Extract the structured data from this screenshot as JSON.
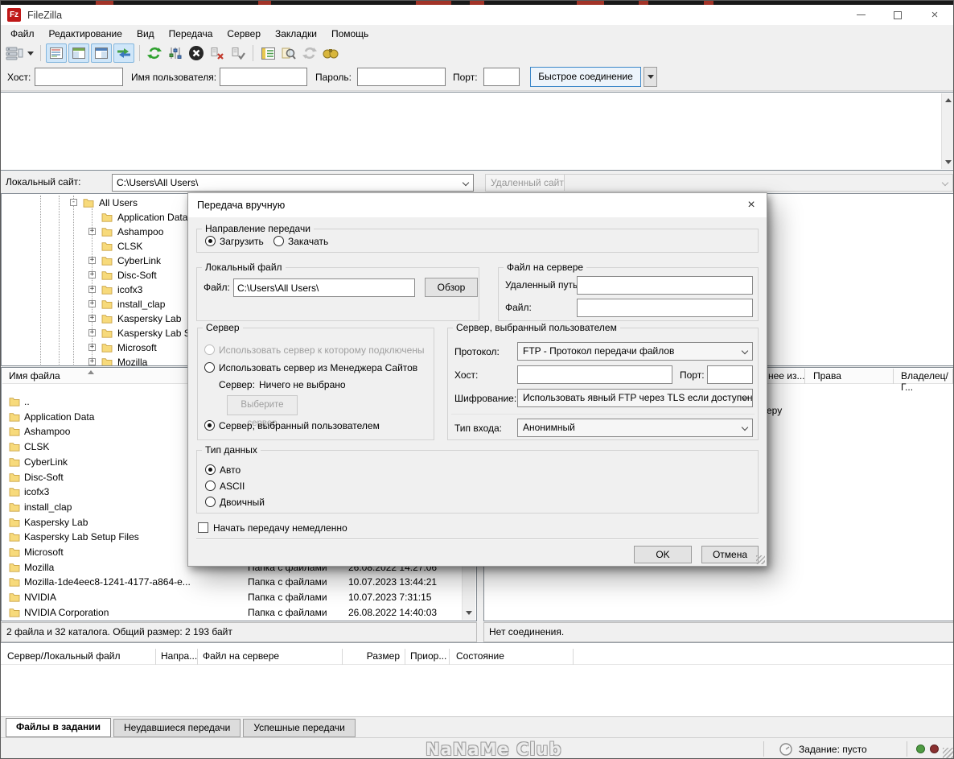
{
  "colors": {
    "accent_blue": "#3c87c8",
    "folder_yellow": "#f7da7b",
    "toggle_bg": "#cfe6f9",
    "status_green": "#4f9b43",
    "status_red": "#8a3030",
    "logo_red": "#bf1818"
  },
  "titlebar": {
    "app_title": "FileZilla",
    "logo_text": "Fz"
  },
  "menu": {
    "items": [
      "Файл",
      "Редактирование",
      "Вид",
      "Передача",
      "Сервер",
      "Закладки",
      "Помощь"
    ]
  },
  "toolbar": {
    "icons": [
      "site-manager",
      "site-manager-dropdown",
      "toggle-log",
      "toggle-local-tree",
      "toggle-remote-tree",
      "toggle-queue",
      "refresh",
      "process-queue",
      "cancel",
      "disconnect",
      "reconnect",
      "filter",
      "search",
      "synchronized-browsing",
      "compare"
    ]
  },
  "quickconnect": {
    "host_label": "Хост:",
    "host_value": "",
    "user_label": "Имя пользователя:",
    "user_value": "",
    "password_label": "Пароль:",
    "password_value": "",
    "port_label": "Порт:",
    "port_value": "",
    "connect_button": "Быстрое соединение"
  },
  "local_bar": {
    "label": "Локальный сайт:",
    "path": "C:\\Users\\All Users\\"
  },
  "remote_bar": {
    "label": "Удаленный сайт:",
    "path": ""
  },
  "local_tree": {
    "items": [
      {
        "label": "All Users",
        "expander": "minus",
        "level": 3
      },
      {
        "label": "Application Data",
        "expander": "none",
        "level": 4
      },
      {
        "label": "Ashampoo",
        "expander": "plus",
        "level": 4
      },
      {
        "label": "CLSK",
        "expander": "none",
        "level": 4
      },
      {
        "label": "CyberLink",
        "expander": "plus",
        "level": 4
      },
      {
        "label": "Disc-Soft",
        "expander": "plus",
        "level": 4
      },
      {
        "label": "icofx3",
        "expander": "plus",
        "level": 4
      },
      {
        "label": "install_clap",
        "expander": "plus",
        "level": 4
      },
      {
        "label": "Kaspersky Lab",
        "expander": "plus",
        "level": 4
      },
      {
        "label": "Kaspersky Lab Setup Files",
        "expander": "plus",
        "level": 4
      },
      {
        "label": "Microsoft",
        "expander": "plus",
        "level": 4
      },
      {
        "label": "Mozilla",
        "expander": "plus",
        "level": 4
      }
    ]
  },
  "local_list": {
    "name_header": "Имя файла",
    "rows": [
      {
        "name": "..",
        "type": "",
        "modified": ""
      },
      {
        "name": "Application Data",
        "type": "",
        "modified": ""
      },
      {
        "name": "Ashampoo",
        "type": "",
        "modified": ""
      },
      {
        "name": "CLSK",
        "type": "",
        "modified": ""
      },
      {
        "name": "CyberLink",
        "type": "",
        "modified": ""
      },
      {
        "name": "Disc-Soft",
        "type": "",
        "modified": ""
      },
      {
        "name": "icofx3",
        "type": "",
        "modified": ""
      },
      {
        "name": "install_clap",
        "type": "",
        "modified": ""
      },
      {
        "name": "Kaspersky Lab",
        "type": "",
        "modified": ""
      },
      {
        "name": "Kaspersky Lab Setup Files",
        "type": "",
        "modified": ""
      },
      {
        "name": "Microsoft",
        "type": "",
        "modified": ""
      },
      {
        "name": "Mozilla",
        "type": "Папка с файлами",
        "modified": "26.08.2022 14:27:06"
      },
      {
        "name": "Mozilla-1de4eec8-1241-4177-a864-e...",
        "type": "Папка с файлами",
        "modified": "10.07.2023 13:44:21"
      },
      {
        "name": "NVIDIA",
        "type": "Папка с файлами",
        "modified": "10.07.2023 7:31:15"
      },
      {
        "name": "NVIDIA Corporation",
        "type": "Папка с файлами",
        "modified": "26.08.2022 14:40:03"
      }
    ],
    "status": "2 файла и 32 каталога. Общий размер: 2 193 байт"
  },
  "remote_panel": {
    "headers": [
      "нее из...",
      "Права",
      "Владелец/Г..."
    ],
    "message_fragment": "еру",
    "status": "Нет соединения."
  },
  "queue": {
    "headers": [
      "Сервер/Локальный файл",
      "Напра...",
      "Файл на сервере",
      "Размер",
      "Приор...",
      "Состояние"
    ]
  },
  "bottom_tabs": {
    "items": [
      "Файлы в задании",
      "Неудавшиеся передачи",
      "Успешные передачи"
    ],
    "active_index": 0
  },
  "statusbar": {
    "watermark": "NaNaMe Club",
    "queue_status": "Задание: пусто"
  },
  "dialog": {
    "title": "Передача вручную",
    "direction_group": {
      "label": "Направление передачи",
      "options": [
        {
          "label": "Загрузить",
          "selected": true
        },
        {
          "label": "Закачать",
          "selected": false
        }
      ]
    },
    "local_file_group": {
      "label": "Локальный файл",
      "file_label": "Файл:",
      "file_value": "C:\\Users\\All Users\\",
      "browse_button": "Обзор"
    },
    "server_file_group": {
      "label": "Файл на сервере",
      "remote_path_label": "Удаленный путь:",
      "remote_path_value": "",
      "file_label": "Файл:",
      "file_value": ""
    },
    "server_group": {
      "label": "Сервер",
      "use_current": "Использовать сервер к которому подключены",
      "use_sitemanager": "Использовать сервер из Менеджера Сайтов",
      "server_label": "Сервер:",
      "server_value": "Ничего не выбрано",
      "choose_button": "Выберите сервер",
      "use_custom": "Сервер, выбранный пользователем"
    },
    "custom_server_group": {
      "label": "Сервер, выбранный пользователем",
      "protocol_label": "Протокол:",
      "protocol_value": "FTP - Протокол передачи файлов",
      "host_label": "Хост:",
      "host_value": "",
      "port_label": "Порт:",
      "port_value": "",
      "encryption_label": "Шифрование:",
      "encryption_value": "Использовать явный FTP через TLS если доступен",
      "logon_label": "Тип входа:",
      "logon_value": "Анонимный"
    },
    "data_type_group": {
      "label": "Тип данных",
      "options": [
        {
          "label": "Авто",
          "selected": true
        },
        {
          "label": "ASCII",
          "selected": false
        },
        {
          "label": "Двоичный",
          "selected": false
        }
      ]
    },
    "immediate_checkbox": {
      "label": "Начать передачу немедленно",
      "checked": false
    },
    "ok_button": "OK",
    "cancel_button": "Отмена"
  }
}
